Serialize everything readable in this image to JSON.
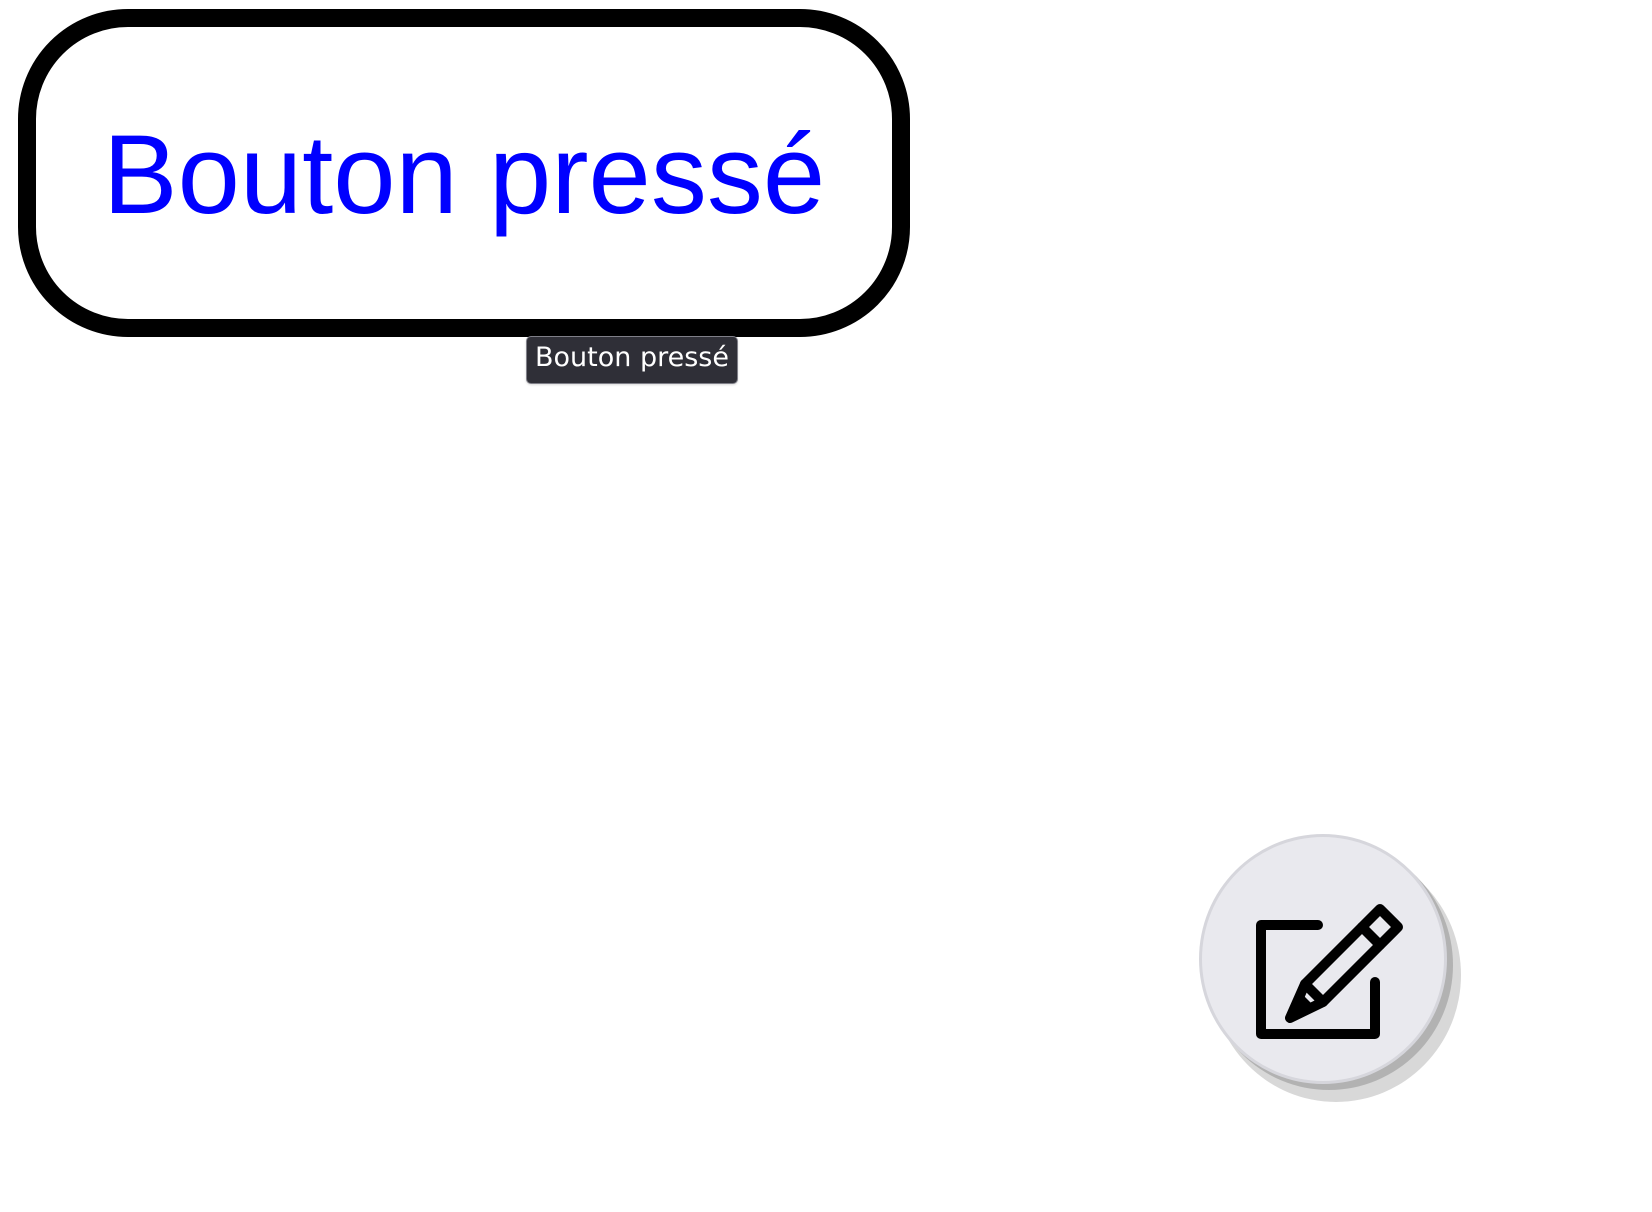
{
  "main_button": {
    "label": "Bouton pressé",
    "text_color": "#0000ff",
    "border_color": "#000000",
    "background": "#ffffff"
  },
  "tooltip": {
    "text": "Bouton pressé",
    "background": "#2f2f37",
    "text_color": "#ffffff"
  },
  "fab": {
    "icon": "edit-square-icon",
    "background": "#e9e9ee"
  }
}
